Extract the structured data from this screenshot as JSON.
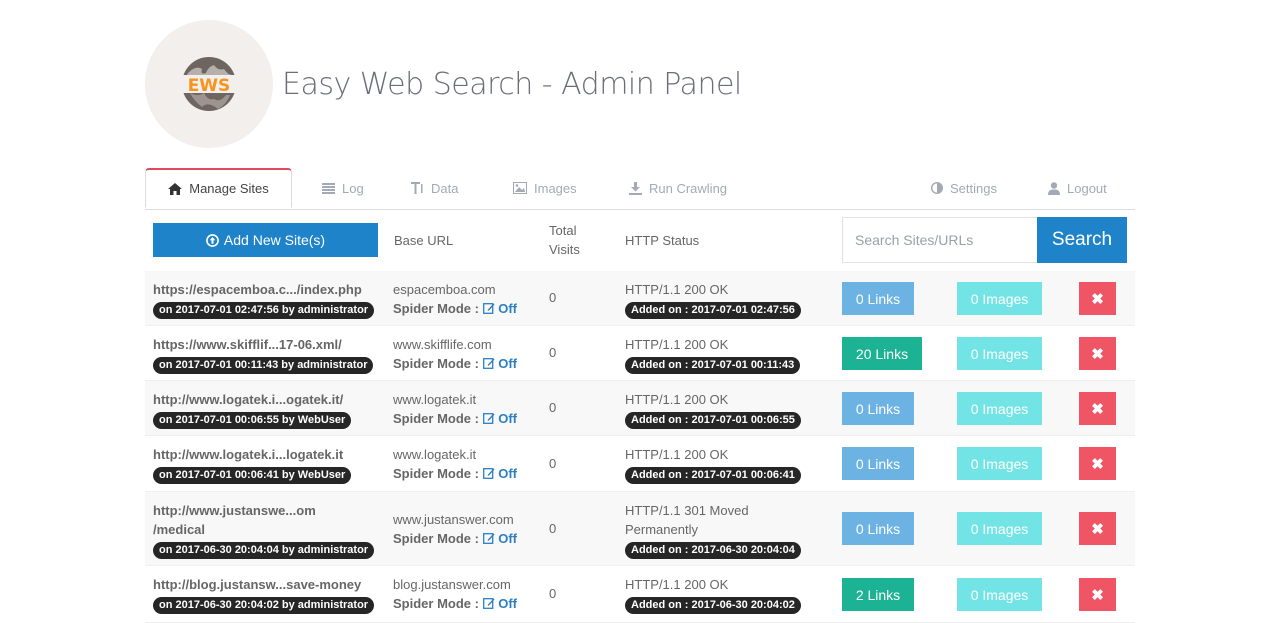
{
  "app": {
    "title": "Easy Web Search - Admin Panel",
    "logo_text": "EWS"
  },
  "tabs": [
    {
      "label": "Manage Sites",
      "icon": "home-icon",
      "active": true
    },
    {
      "label": "Log",
      "icon": "list-icon",
      "active": false
    },
    {
      "label": "Data",
      "icon": "text-height-icon",
      "active": false
    },
    {
      "label": "Images",
      "icon": "picture-icon",
      "active": false
    },
    {
      "label": "Run Crawling",
      "icon": "download-icon",
      "active": false
    },
    {
      "label": "Settings",
      "icon": "adjust-icon",
      "active": false
    },
    {
      "label": "Logout",
      "icon": "user-icon",
      "active": false
    }
  ],
  "toolbar": {
    "add_label": "Add New Site(s)",
    "columns": {
      "base_url": "Base URL",
      "total_visits_1": "Total",
      "total_visits_2": "Visits",
      "http_status": "HTTP Status"
    },
    "search_placeholder": "Search Sites/URLs",
    "search_value": "",
    "search_label": "Search"
  },
  "colors": {
    "primary": "#1f83c9",
    "links_zero": "#6cb3e3",
    "links_nonzero": "#1bb394",
    "images": "#73e4e5",
    "delete": "#ef5565",
    "active_tab_accent": "#e04a5a",
    "spider_off": "#2b7fc3"
  },
  "spider_label": "Spider Mode :",
  "sites": [
    {
      "url_lines": [
        "https://espacemboa.c.../index.php"
      ],
      "added_by": "on 2017-07-01 02:47:56 by administrator",
      "base_url": "espacemboa.com",
      "spider": "Off",
      "visits": "0",
      "status_lines": [
        "HTTP/1.1 200 OK"
      ],
      "added_on": "Added on : 2017-07-01 02:47:56",
      "links": "0 Links",
      "links_count": 0,
      "images": "0 Images",
      "delete": "✖"
    },
    {
      "url_lines": [
        "https://www.skifflif...17-06.xml/"
      ],
      "added_by": "on 2017-07-01 00:11:43 by administrator",
      "base_url": "www.skifflife.com",
      "spider": "Off",
      "visits": "0",
      "status_lines": [
        "HTTP/1.1 200 OK"
      ],
      "added_on": "Added on : 2017-07-01 00:11:43",
      "links": "20 Links",
      "links_count": 20,
      "images": "0 Images",
      "delete": "✖"
    },
    {
      "url_lines": [
        "http://www.logatek.i...ogatek.it/"
      ],
      "added_by": "on 2017-07-01 00:06:55 by WebUser",
      "base_url": "www.logatek.it",
      "spider": "Off",
      "visits": "0",
      "status_lines": [
        "HTTP/1.1 200 OK"
      ],
      "added_on": "Added on : 2017-07-01 00:06:55",
      "links": "0 Links",
      "links_count": 0,
      "images": "0 Images",
      "delete": "✖"
    },
    {
      "url_lines": [
        "http://www.logatek.i...logatek.it"
      ],
      "added_by": "on 2017-07-01 00:06:41 by WebUser",
      "base_url": "www.logatek.it",
      "spider": "Off",
      "visits": "0",
      "status_lines": [
        "HTTP/1.1 200 OK"
      ],
      "added_on": "Added on : 2017-07-01 00:06:41",
      "links": "0 Links",
      "links_count": 0,
      "images": "0 Images",
      "delete": "✖"
    },
    {
      "url_lines": [
        "http://www.justanswe...om",
        "/medical"
      ],
      "added_by": "on 2017-06-30 20:04:04 by administrator",
      "base_url": "www.justanswer.com",
      "spider": "Off",
      "visits": "0",
      "status_lines": [
        "HTTP/1.1 301 Moved",
        "Permanently"
      ],
      "added_on": "Added on : 2017-06-30 20:04:04",
      "links": "0 Links",
      "links_count": 0,
      "images": "0 Images",
      "delete": "✖"
    },
    {
      "url_lines": [
        "http://blog.justansw...save-money"
      ],
      "added_by": "on 2017-06-30 20:04:02 by administrator",
      "base_url": "blog.justanswer.com",
      "spider": "Off",
      "visits": "0",
      "status_lines": [
        "HTTP/1.1 200 OK"
      ],
      "added_on": "Added on : 2017-06-30 20:04:02",
      "links": "2 Links",
      "links_count": 2,
      "images": "0 Images",
      "delete": "✖"
    }
  ]
}
